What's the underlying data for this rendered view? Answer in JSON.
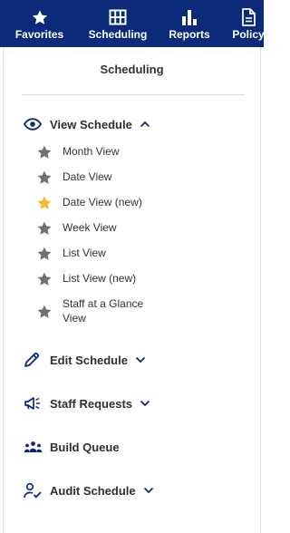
{
  "topnav": {
    "items": [
      {
        "label": "Favorites",
        "icon": "star-icon"
      },
      {
        "label": "Scheduling",
        "icon": "grid-calendar-icon"
      },
      {
        "label": "Reports",
        "icon": "bar-chart-icon"
      },
      {
        "label": "Policy",
        "icon": "document-icon"
      }
    ],
    "background": "#0b2a7a"
  },
  "panel": {
    "title": "Scheduling",
    "sections": [
      {
        "label": "View Schedule",
        "icon": "eye-icon",
        "expanded": true,
        "items": [
          {
            "label": "Month View",
            "starred": false
          },
          {
            "label": "Date View",
            "starred": false
          },
          {
            "label": "Date View (new)",
            "starred": true
          },
          {
            "label": "Week View",
            "starred": false
          },
          {
            "label": "List View",
            "starred": false
          },
          {
            "label": "List View (new)",
            "starred": false
          },
          {
            "label": "Staff at a Glance View",
            "starred": false
          }
        ]
      },
      {
        "label": "Edit Schedule",
        "icon": "pencil-icon",
        "expanded": false
      },
      {
        "label": "Staff Requests",
        "icon": "megaphone-icon",
        "expanded": false
      },
      {
        "label": "Build Queue",
        "icon": "people-group-icon"
      },
      {
        "label": "Audit Schedule",
        "icon": "user-check-icon",
        "expanded": false
      }
    ]
  },
  "colors": {
    "accent": "#0b2a7a",
    "star_default": "#707070",
    "star_active": "#f5b82e"
  }
}
